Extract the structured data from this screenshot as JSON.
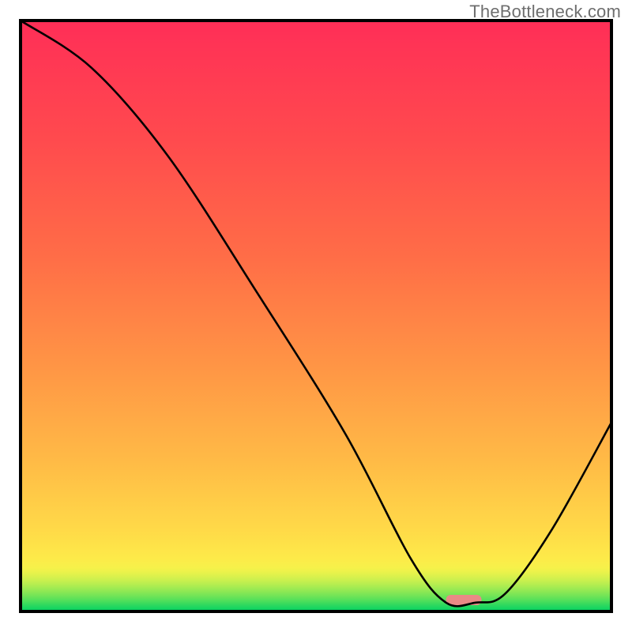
{
  "watermark": "TheBottleneck.com",
  "chart_data": {
    "type": "line",
    "title": "",
    "xlabel": "",
    "ylabel": "",
    "xlim": [
      0,
      100
    ],
    "ylim": [
      0,
      100
    ],
    "series": [
      {
        "name": "bottleneck-curve",
        "x": [
          0,
          12,
          25,
          40,
          55,
          66,
          72,
          77,
          82,
          90,
          100
        ],
        "values": [
          100,
          92,
          77,
          54,
          30,
          9,
          1.5,
          1.5,
          3,
          14,
          32
        ]
      }
    ],
    "marker": {
      "name": "target-range",
      "x_start": 72,
      "x_end": 78,
      "y": 2,
      "color": "#e98a86"
    },
    "background_bands": [
      {
        "y": 0,
        "color": "#00d062"
      },
      {
        "y": 1.0,
        "color": "#2bd85f"
      },
      {
        "y": 1.8,
        "color": "#4fdf5b"
      },
      {
        "y": 2.6,
        "color": "#70e457"
      },
      {
        "y": 3.4,
        "color": "#8ee854"
      },
      {
        "y": 4.2,
        "color": "#a9ec51"
      },
      {
        "y": 5.0,
        "color": "#c2ef4f"
      },
      {
        "y": 5.8,
        "color": "#d7f14d"
      },
      {
        "y": 6.6,
        "color": "#e9f24b"
      },
      {
        "y": 7.4,
        "color": "#f6f14a"
      },
      {
        "y": 9.0,
        "color": "#fdea49"
      },
      {
        "y": 14,
        "color": "#ffd948"
      },
      {
        "y": 26,
        "color": "#ffb946"
      },
      {
        "y": 42,
        "color": "#ff9445"
      },
      {
        "y": 60,
        "color": "#ff6d47"
      },
      {
        "y": 80,
        "color": "#ff4a4e"
      },
      {
        "y": 100,
        "color": "#ff2e57"
      }
    ],
    "grid": false,
    "legend": false,
    "axes_visible": false
  }
}
